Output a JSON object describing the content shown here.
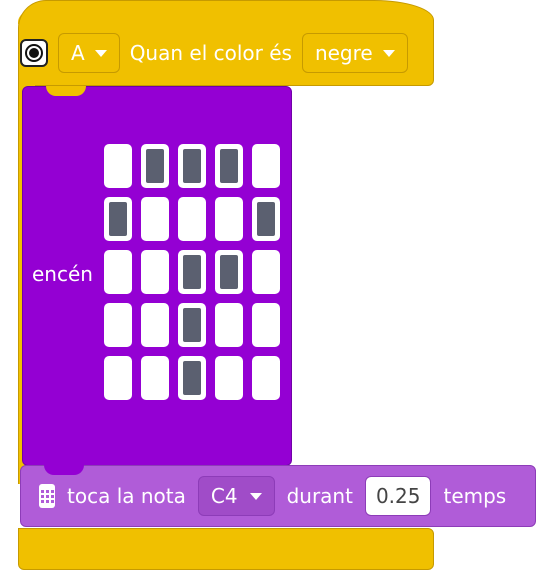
{
  "event_block": {
    "button_option": "A",
    "condition_label": "Quan el color és",
    "color_option": "negre",
    "icon": "target-icon"
  },
  "led_block": {
    "label": "encén",
    "grid": [
      [
        0,
        1,
        1,
        1,
        0
      ],
      [
        1,
        0,
        0,
        0,
        1
      ],
      [
        0,
        0,
        1,
        1,
        0
      ],
      [
        0,
        0,
        1,
        0,
        0
      ],
      [
        0,
        0,
        1,
        0,
        0
      ]
    ]
  },
  "sound_block": {
    "icon": "microbit-icon",
    "action_label": "toca la nota",
    "note": "C4",
    "during_label": "durant",
    "beats": "0.25",
    "unit_label": "temps"
  },
  "colors": {
    "event": "#f0c000",
    "looks": "#9400d3",
    "sound": "#b05cd8"
  }
}
